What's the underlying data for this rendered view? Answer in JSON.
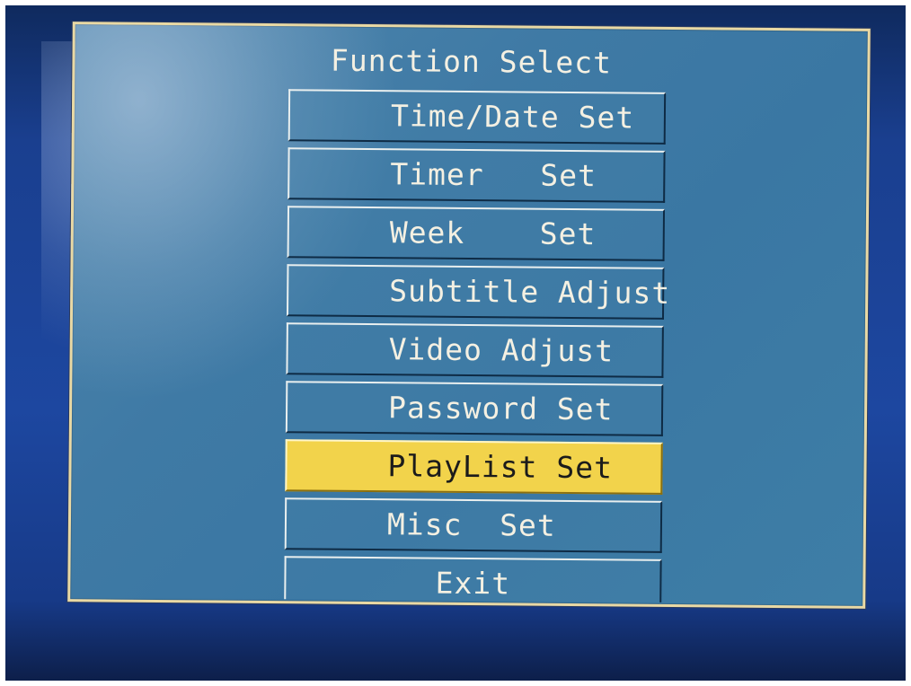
{
  "menu": {
    "title": "Function Select",
    "selected_index": 6,
    "colors": {
      "panel": "#3f7aa5",
      "border": "#e9d9a4",
      "text": "#f4f0e2",
      "highlight": "#f2d34b",
      "highlight_text": "#1b1b1b"
    },
    "items": [
      {
        "label": "Time/Date Set"
      },
      {
        "label": "Timer   Set"
      },
      {
        "label": "Week    Set"
      },
      {
        "label": "Subtitle Adjust"
      },
      {
        "label": "Video Adjust"
      },
      {
        "label": "Password Set"
      },
      {
        "label": "PlayList Set"
      },
      {
        "label": "Misc  Set"
      },
      {
        "label": "Exit"
      }
    ]
  }
}
